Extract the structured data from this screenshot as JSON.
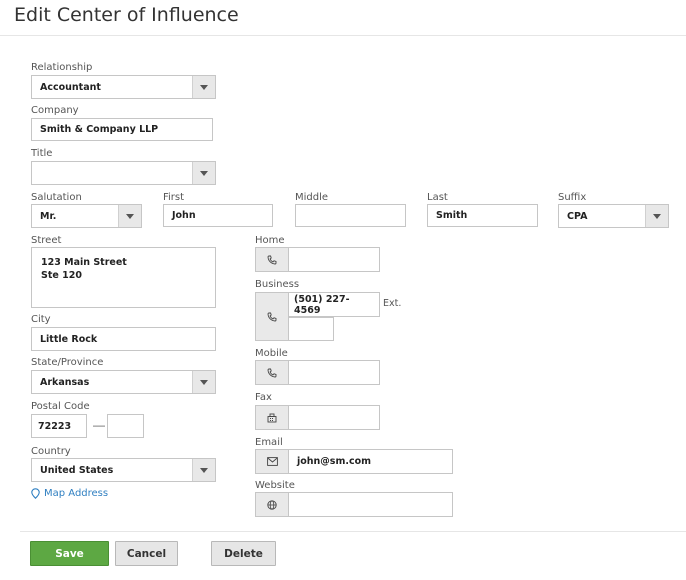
{
  "page": {
    "title": "Edit Center of Influence"
  },
  "form": {
    "relationship": {
      "label": "Relationship",
      "value": "Accountant"
    },
    "company": {
      "label": "Company",
      "value": "Smith & Company LLP"
    },
    "title": {
      "label": "Title",
      "value": ""
    },
    "salutation": {
      "label": "Salutation",
      "value": "Mr."
    },
    "first": {
      "label": "First",
      "value": "John"
    },
    "middle": {
      "label": "Middle",
      "value": ""
    },
    "last": {
      "label": "Last",
      "value": "Smith"
    },
    "suffix": {
      "label": "Suffix",
      "value": "CPA"
    },
    "street": {
      "label": "Street",
      "value": "123 Main Street\nSte 120"
    },
    "city": {
      "label": "City",
      "value": "Little Rock"
    },
    "state": {
      "label": "State/Province",
      "value": "Arkansas"
    },
    "postal": {
      "label": "Postal Code",
      "value": "72223",
      "extension": "",
      "separator": "—"
    },
    "country": {
      "label": "Country",
      "value": "United States"
    },
    "map_link": "Map Address",
    "home": {
      "label": "Home",
      "value": ""
    },
    "business": {
      "label": "Business",
      "value": "(501) 227-4569",
      "ext_label": "Ext.",
      "ext_value": ""
    },
    "mobile": {
      "label": "Mobile",
      "value": ""
    },
    "fax": {
      "label": "Fax",
      "value": ""
    },
    "email": {
      "label": "Email",
      "value": "john@sm.com"
    },
    "website": {
      "label": "Website",
      "value": ""
    }
  },
  "icons": {
    "phone": "phone-icon",
    "fax": "fax-icon",
    "email": "envelope-icon",
    "website": "globe-icon",
    "map": "map-pin-icon",
    "dropdown": "chevron-down-icon"
  },
  "actions": {
    "save": "Save",
    "cancel": "Cancel",
    "delete": "Delete"
  },
  "colors": {
    "save": "#5da843",
    "link": "#2f7fc1",
    "icon_bg": "#e9e9e9"
  }
}
